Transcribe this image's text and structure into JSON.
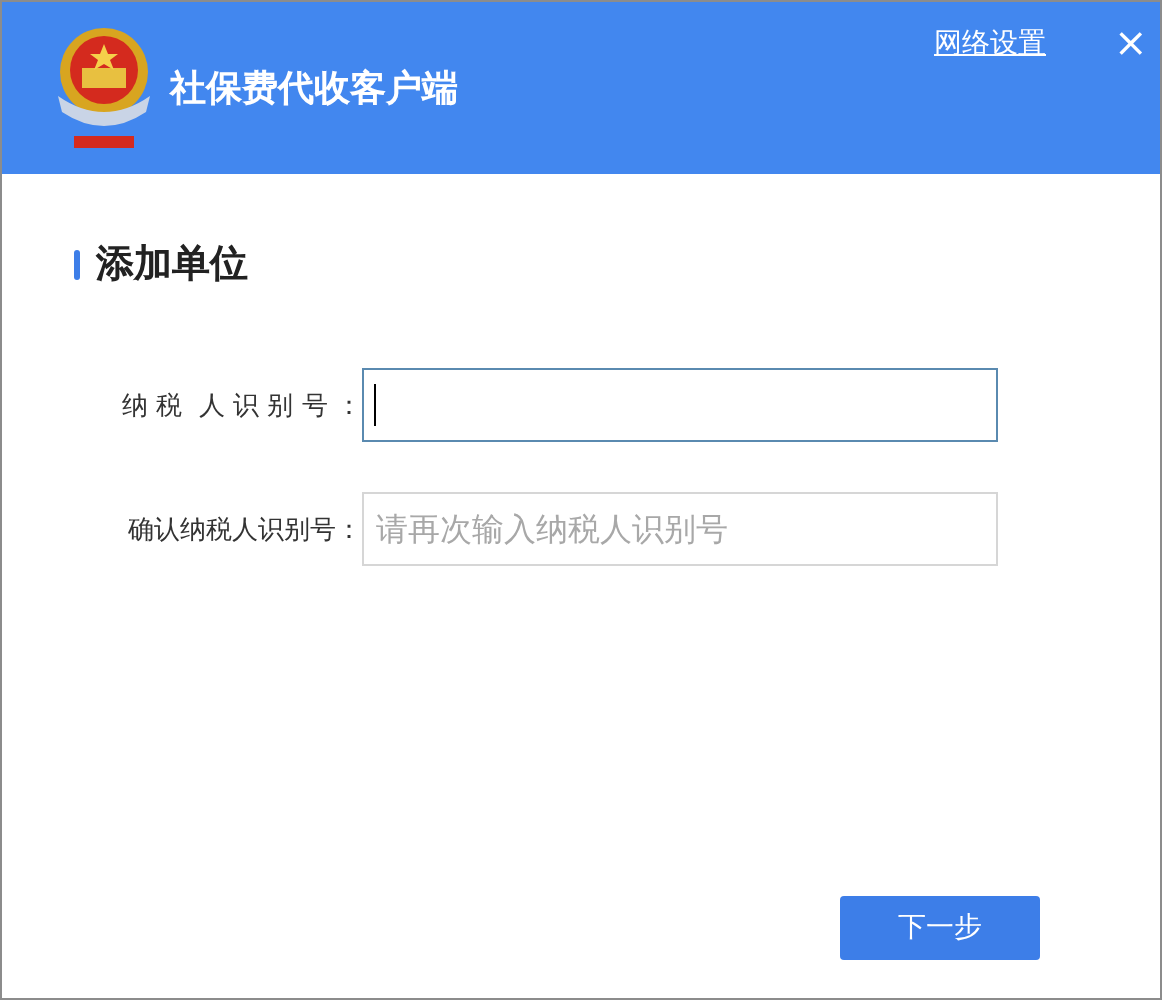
{
  "window": {
    "title": "社保费代收客户端",
    "network_settings": "网络设置",
    "close": "×"
  },
  "section": {
    "title": "添加单位"
  },
  "fields": [
    {
      "label": "纳 税  人 识 别 号 ：",
      "focused": true
    },
    {
      "label": "确认纳税人识别号：",
      "placeholder": "请再次输入纳税人识别号",
      "focused": false
    }
  ],
  "buttons": [
    {
      "label": "下一步"
    }
  ]
}
